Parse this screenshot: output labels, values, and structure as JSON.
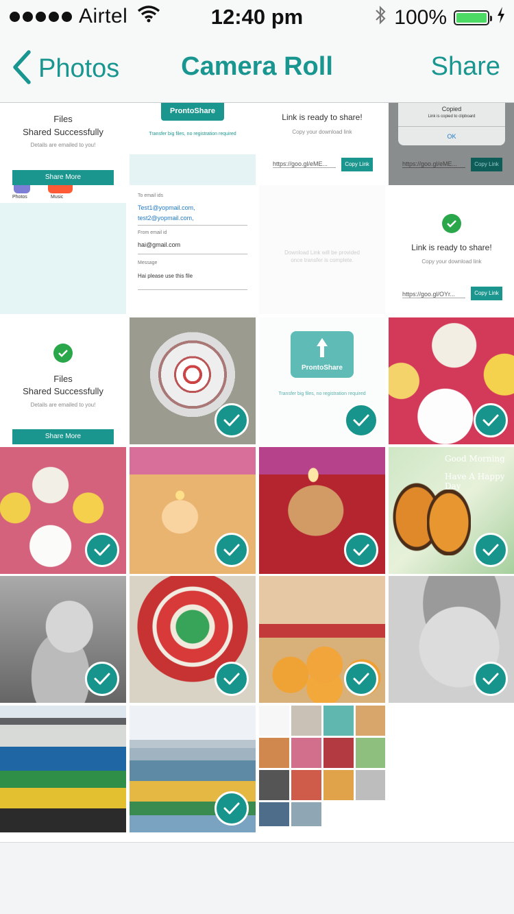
{
  "status_bar": {
    "carrier": "Airtel",
    "time": "12:40 pm",
    "battery": "100%",
    "battery_level": 1.0
  },
  "nav": {
    "back_label": "Photos",
    "title": "Camera Roll",
    "action_label": "Share"
  },
  "colors": {
    "accent": "#1a9690",
    "check_badge": "#17948c",
    "success_green": "#2aa74a"
  },
  "screens": {
    "files_shared": {
      "title_line1": "Files",
      "title_line2": "Shared Successfully",
      "subtitle": "Details are emailed to you!",
      "button": "Share More"
    },
    "prontoshare": {
      "logo": "ProntoShare",
      "tagline": "Transfer big files, no registration required"
    },
    "link_ready": {
      "title": "Link is ready to share!",
      "subtitle": "Copy your download link",
      "link": "https://goo.gl/eME...",
      "button": "Copy Link"
    },
    "copied_alert": {
      "title": "Copied",
      "message": "Link is copied to clipboard",
      "ok": "OK",
      "link": "https://goo.gl/eME...",
      "button": "Copy Link"
    },
    "share_sheet": {
      "app1": "Photos",
      "app2": "Music"
    },
    "email_form": {
      "to_label": "To email ids",
      "to_value1": "Test1@yopmail.com,",
      "to_value2": "test2@yopmail.com,",
      "from_label": "From email id",
      "from_value": "hai@gmail.com",
      "message_label": "Message",
      "message_value": "Hai please use this file"
    },
    "pending": {
      "text_line1": "Download Link will be provided",
      "text_line2": "once transfer is complete."
    },
    "link_ready2": {
      "title": "Link is ready to share!",
      "subtitle": "Copy your download link",
      "link": "https://goo.gl/OYr...",
      "button": "Copy Link"
    },
    "butterfly_greeting": {
      "line1": "Good Morning",
      "line2": "Have A Happy Day"
    }
  },
  "photos": [
    {
      "name": "files-shared-screenshot",
      "selected": false
    },
    {
      "name": "prontoshare-logo-screenshot",
      "selected": false
    },
    {
      "name": "link-ready-screenshot",
      "selected": false
    },
    {
      "name": "copied-alert-screenshot",
      "selected": false
    },
    {
      "name": "share-sheet-screenshot",
      "selected": false
    },
    {
      "name": "email-form-screenshot",
      "selected": false
    },
    {
      "name": "pending-link-screenshot",
      "selected": false
    },
    {
      "name": "link-ready-2-screenshot",
      "selected": false
    },
    {
      "name": "files-shared-2-screenshot",
      "selected": false
    },
    {
      "name": "rangoli-photo",
      "selected": true
    },
    {
      "name": "prontoshare-folder-screenshot",
      "selected": true
    },
    {
      "name": "flowers-photo",
      "selected": true
    },
    {
      "name": "flower-bowl-photo",
      "selected": true
    },
    {
      "name": "diya-petals-photo",
      "selected": true
    },
    {
      "name": "diya-closeup-photo",
      "selected": true
    },
    {
      "name": "butterfly-greeting-photo",
      "selected": true
    },
    {
      "name": "teddy-bear-photo",
      "selected": true
    },
    {
      "name": "ganesha-rangoli-photo",
      "selected": true
    },
    {
      "name": "laddoo-offering-photo",
      "selected": true
    },
    {
      "name": "baby-photo",
      "selected": true
    },
    {
      "name": "crowd-pavilion-photo",
      "selected": false
    },
    {
      "name": "crowd-beach-photo",
      "selected": true
    },
    {
      "name": "collage-screenshot",
      "selected": false
    }
  ]
}
